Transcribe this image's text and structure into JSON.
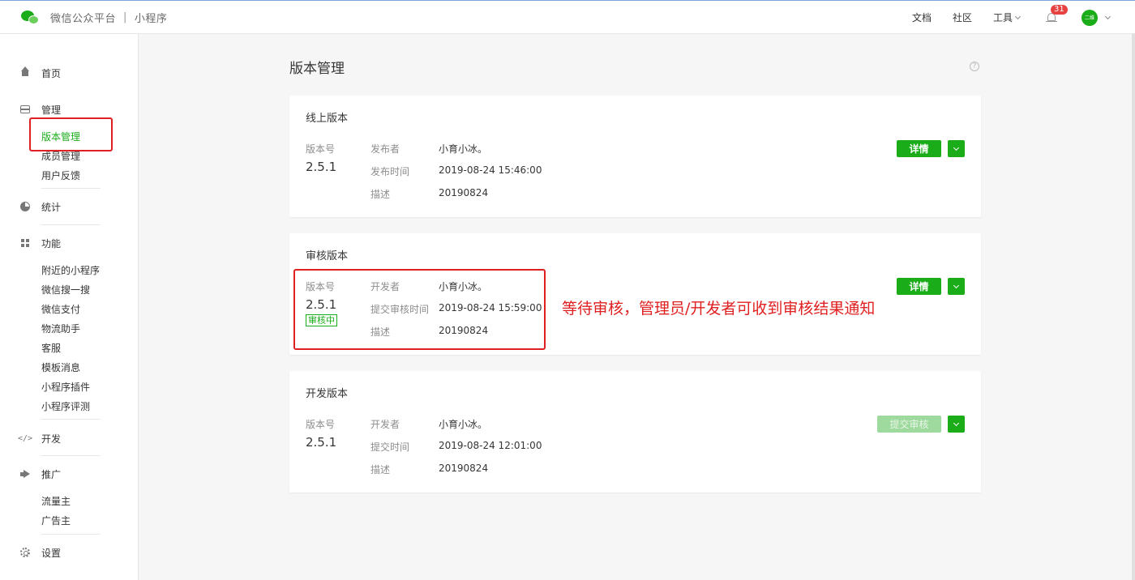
{
  "header": {
    "platform": "微信公众平台",
    "separator": "|",
    "product": "小程序",
    "nav": {
      "docs": "文档",
      "community": "社区",
      "tools": "工具"
    },
    "notification_count": "31",
    "avatar_text": "二维"
  },
  "sidebar": {
    "home": "首页",
    "manage": {
      "label": "管理",
      "items": [
        "版本管理",
        "成员管理",
        "用户反馈"
      ]
    },
    "stats": "统计",
    "features": {
      "label": "功能",
      "items": [
        "附近的小程序",
        "微信搜一搜",
        "微信支付",
        "物流助手",
        "客服",
        "模板消息",
        "小程序插件",
        "小程序评测"
      ]
    },
    "develop": "开发",
    "promote": {
      "label": "推广",
      "items": [
        "流量主",
        "广告主"
      ]
    },
    "settings": "设置"
  },
  "main": {
    "title": "版本管理",
    "help_glyph": "?",
    "online": {
      "title": "线上版本",
      "version_label": "版本号",
      "version": "2.5.1",
      "rows": [
        {
          "label": "发布者",
          "value": "小育小冰。"
        },
        {
          "label": "发布时间",
          "value": "2019-08-24 15:46:00"
        },
        {
          "label": "描述",
          "value": "20190824"
        }
      ],
      "button": "详情"
    },
    "review": {
      "title": "审核版本",
      "version_label": "版本号",
      "version": "2.5.1",
      "status": "审核中",
      "rows": [
        {
          "label": "开发者",
          "value": "小育小冰。"
        },
        {
          "label": "提交审核时间",
          "value": "2019-08-24 15:59:00"
        },
        {
          "label": "描述",
          "value": "20190824"
        }
      ],
      "button": "详情"
    },
    "dev": {
      "title": "开发版本",
      "version_label": "版本号",
      "version": "2.5.1",
      "rows": [
        {
          "label": "开发者",
          "value": "小育小冰。"
        },
        {
          "label": "提交时间",
          "value": "2019-08-24 12:01:00"
        },
        {
          "label": "描述",
          "value": "20190824"
        }
      ],
      "button": "提交审核"
    }
  },
  "annotation": "等待审核，管理员/开发者可收到审核结果通知",
  "colors": {
    "accent": "#1aad19",
    "highlight": "#e02020",
    "badge": "#e64340"
  }
}
